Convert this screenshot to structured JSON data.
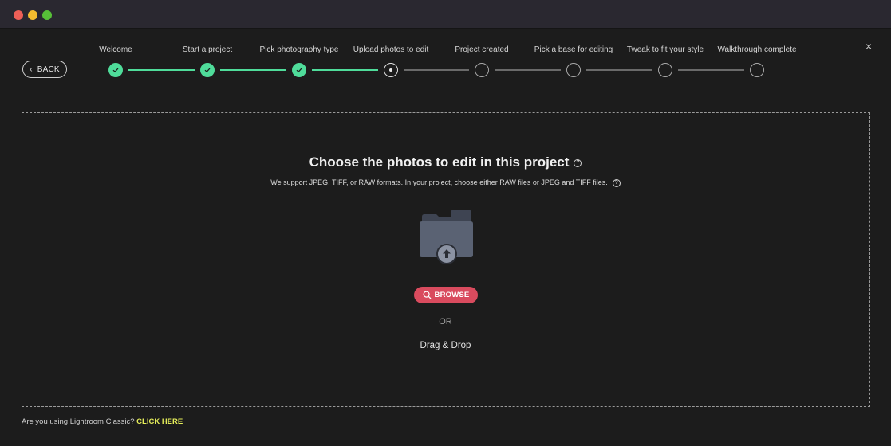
{
  "window": {
    "traffic_lights": [
      "close",
      "minimize",
      "zoom"
    ],
    "colors": {
      "red": "#ee5f57",
      "yellow": "#f4bc2f",
      "green": "#57c038"
    }
  },
  "nav": {
    "back_label": "BACK",
    "close_label": "×"
  },
  "steps": [
    {
      "label": "Welcome",
      "state": "done"
    },
    {
      "label": "Start a project",
      "state": "done"
    },
    {
      "label": "Pick photography type",
      "state": "done"
    },
    {
      "label": "Upload photos to edit",
      "state": "current"
    },
    {
      "label": "Project  created",
      "state": "todo"
    },
    {
      "label": "Pick a base for editing",
      "state": "todo"
    },
    {
      "label": "Tweak to fit your style",
      "state": "todo"
    },
    {
      "label": "Walkthrough complete",
      "state": "todo"
    }
  ],
  "main": {
    "title": "Choose the photos to edit in this project",
    "help_glyph": "?",
    "subtitle": "We support JPEG, TIFF,  or RAW formats. In your project, choose either RAW files or JPEG and TIFF files.",
    "folder_icon": "folder-upload-icon",
    "browse_label": "BROWSE",
    "or_label": "OR",
    "drag_label": "Drag & Drop"
  },
  "footer": {
    "question": "Are you using Lightroom Classic?",
    "link_label": "CLICK HERE"
  },
  "colors": {
    "background": "#1c1c1c",
    "accent_done": "#4fdc9a",
    "browse": "#d94b5e",
    "link": "#e6ee5a"
  }
}
